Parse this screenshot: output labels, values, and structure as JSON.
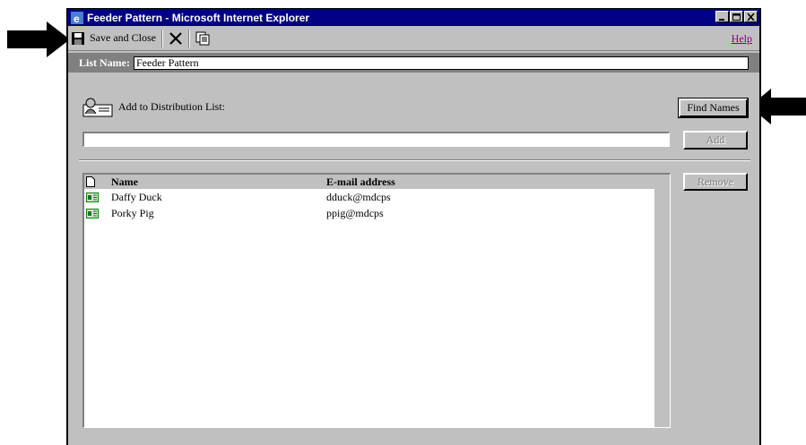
{
  "window": {
    "title": "Feeder Pattern - Microsoft Internet Explorer"
  },
  "toolbar": {
    "save_close_label": "Save and Close",
    "help_label": "Help"
  },
  "list_name": {
    "label": "List Name:",
    "value": "Feeder Pattern"
  },
  "distribution": {
    "label": "Add to Distribution List:",
    "input_value": ""
  },
  "buttons": {
    "find_names": "Find Names",
    "add": "Add",
    "remove": "Remove"
  },
  "members": {
    "columns": {
      "name": "Name",
      "email": "E-mail address"
    },
    "rows": [
      {
        "name": "Daffy Duck",
        "email": "dduck@mdcps"
      },
      {
        "name": "Porky Pig",
        "email": "ppig@mdcps"
      }
    ]
  },
  "colors": {
    "titlebar": "#000080",
    "chrome": "#c0c0c0",
    "listname_bar": "#808080",
    "help_link": "#800080"
  }
}
